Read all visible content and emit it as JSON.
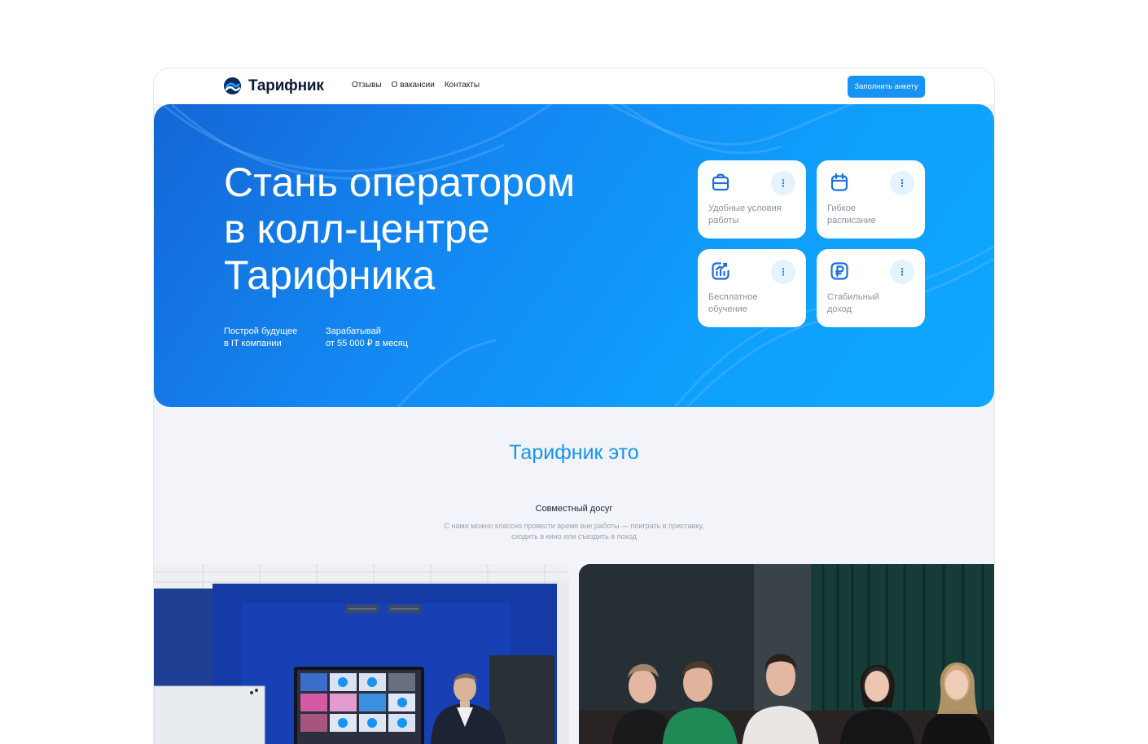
{
  "brand": {
    "name": "Тарифник"
  },
  "nav": {
    "links": [
      "Отзывы",
      "О вакансии",
      "Контакты"
    ],
    "cta_label": "Заполнить анкету"
  },
  "hero": {
    "title_lines": [
      "Стань оператором",
      "в колл-центре",
      "Тарифника"
    ],
    "subtitles": [
      {
        "line1": "Построй будущее",
        "line2": "в IT компании"
      },
      {
        "line1": "Зарабатывай",
        "line2": "от 55 000 ₽ в месяц"
      }
    ]
  },
  "features": [
    {
      "icon": "briefcase-icon",
      "line1": "Удобные условия",
      "line2": "работы"
    },
    {
      "icon": "calendar-icon",
      "line1": "Гибкое",
      "line2": "расписание"
    },
    {
      "icon": "chart-growth-icon",
      "line1": "Бесплатное",
      "line2": "обучение"
    },
    {
      "icon": "ruble-icon",
      "line1": "Стабильный",
      "line2": "доход"
    }
  ],
  "feature_menu_glyph": "⋮",
  "about": {
    "title": "Тарифник это",
    "subsection_title": "Совместный досуг",
    "subsection_desc_line1": "С нами можно классно провести время вне работы — поиграть в приставку,",
    "subsection_desc_line2": "сходить в кино или съездить в поход"
  },
  "colors": {
    "accent": "#1693f5",
    "hero_gradient_start": "#1466d6",
    "hero_gradient_end": "#10a8ff",
    "card_menu_bg": "#e5f3ff",
    "text_dark": "#0b1a33",
    "text_muted": "#8c91a0"
  }
}
